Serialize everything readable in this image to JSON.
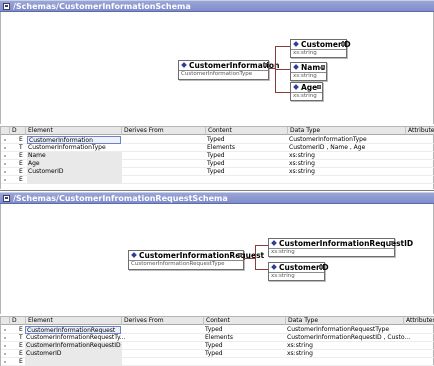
{
  "panel1": {
    "title": "/Schemas/CustomerInformationSchema",
    "root": {
      "name": "CustomerInformation",
      "type": "CustomerInformationType"
    },
    "children": [
      {
        "name": "CustomerID",
        "type": "xs:string"
      },
      {
        "name": "Name",
        "type": "xs:string"
      },
      {
        "name": "Age",
        "type": "xs:string"
      }
    ],
    "grid": {
      "headers": [
        "D",
        "Element",
        "Derives From",
        "Content",
        "Data Type",
        "Attributes"
      ],
      "rows": [
        {
          "kind": "E",
          "element": "CustomerInformation",
          "derives": "",
          "content": "Typed",
          "datatype": "CustomerInformationType"
        },
        {
          "kind": "T",
          "element": "CustomerInformationType",
          "derives": "",
          "content": "Elements",
          "datatype": "CustomerID , Name , Age"
        },
        {
          "kind": "E",
          "element": "Name",
          "derives": "",
          "content": "Typed",
          "datatype": "xs:string"
        },
        {
          "kind": "E",
          "element": "Age",
          "derives": "",
          "content": "Typed",
          "datatype": "xs:string"
        },
        {
          "kind": "E",
          "element": "CustomerID",
          "derives": "",
          "content": "Typed",
          "datatype": "xs:string"
        },
        {
          "kind": "E",
          "element": "",
          "derives": "",
          "content": "",
          "datatype": ""
        }
      ]
    }
  },
  "panel2": {
    "title": "/Schemas/CustomerInfromationRequestSchema",
    "root": {
      "name": "CustomerInformationRequest",
      "type": "CustomerInformationRequestType"
    },
    "children": [
      {
        "name": "CustomerInformationRequestID",
        "type": "xs:string"
      },
      {
        "name": "CustomerID",
        "type": "xs:string"
      }
    ],
    "grid": {
      "headers": [
        "D",
        "Element",
        "Derives From",
        "Content",
        "Data Type",
        "Attributes"
      ],
      "rows": [
        {
          "kind": "E",
          "element": "CustomerInformationRequest",
          "derives": "",
          "content": "Typed",
          "datatype": "CustomerInformationRequestType"
        },
        {
          "kind": "T",
          "element": "CustomerInformationRequestTy...",
          "derives": "",
          "content": "Elements",
          "datatype": "CustomerInformationRequestID , Custo..."
        },
        {
          "kind": "E",
          "element": "CustomerInformationRequestID",
          "derives": "",
          "content": "Typed",
          "datatype": "xs:string"
        },
        {
          "kind": "E",
          "element": "CustomerID",
          "derives": "",
          "content": "Typed",
          "datatype": "xs:string"
        },
        {
          "kind": "E",
          "element": "",
          "derives": "",
          "content": "",
          "datatype": ""
        }
      ]
    }
  },
  "colors": {
    "titlebar": "#8894cf",
    "connector": "#8b3a3a",
    "diamond": "#2d3d99"
  }
}
